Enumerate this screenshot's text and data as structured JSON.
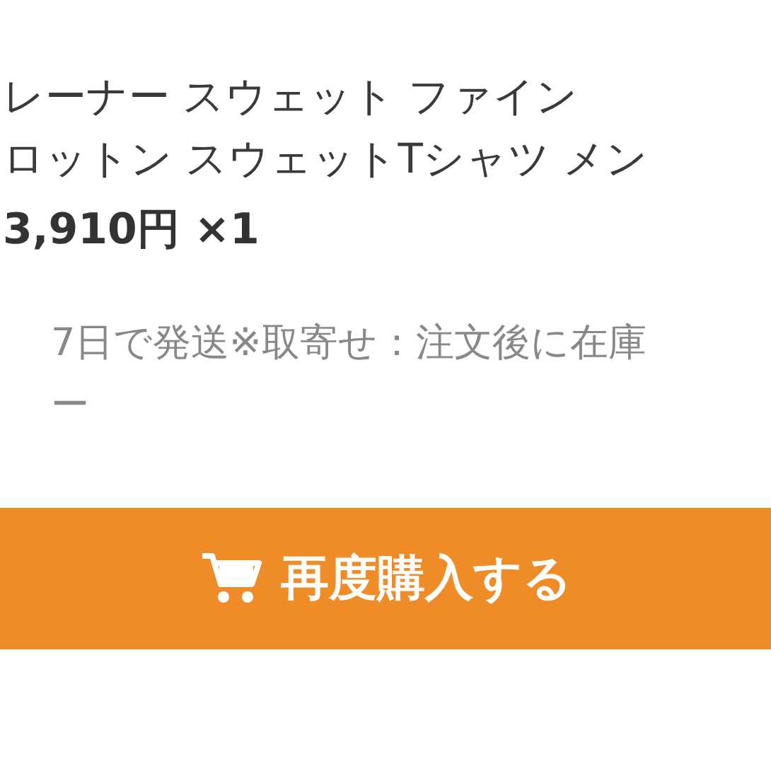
{
  "product": {
    "title_lines": [
      "レーナー スウェット ファイン",
      "ロットン スウェットTシャツ メン"
    ],
    "price": "3,910円 ×1",
    "shipping_lines": [
      "7日で発送※取寄せ：注文後に在庫",
      "ー"
    ]
  },
  "buy_again_button": {
    "label": "再度購入する"
  }
}
